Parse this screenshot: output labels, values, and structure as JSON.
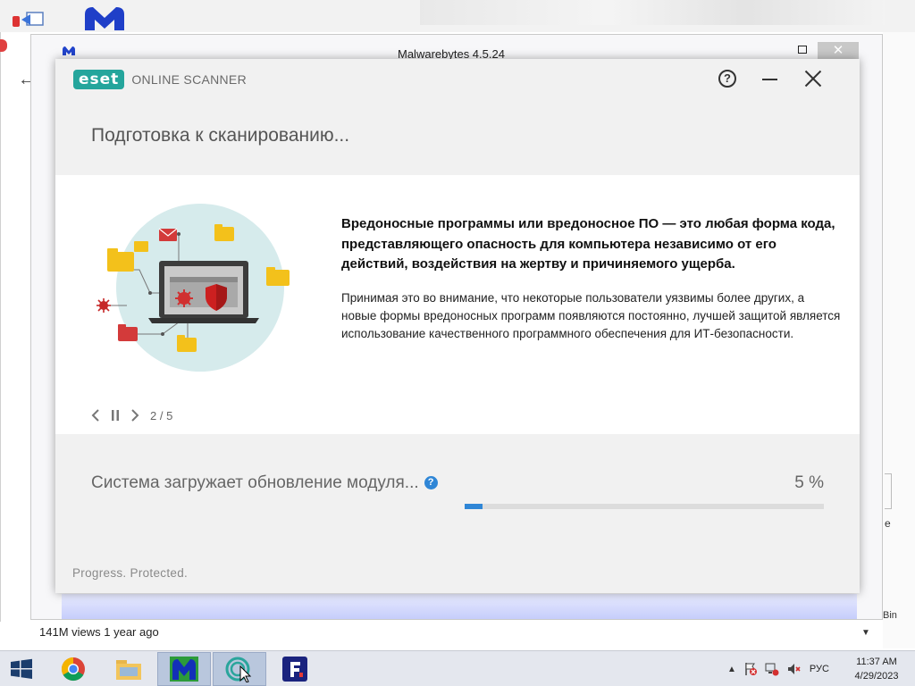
{
  "background": {
    "malwarebytes_title": "Malwarebytes 4.5.24",
    "views_text": "141M views  1 year ago",
    "bin_label": "Bin"
  },
  "eset": {
    "logo_text": "eset",
    "product_name": "ONLINE SCANNER",
    "page_title": "Подготовка к сканированию...",
    "info_heading": "Вредоносные программы или вредоносное ПО — это любая форма кода, представляющего опасность для компьютера независимо от его действий, воздействия на жертву и причиняемого ущерба.",
    "info_body": "Принимая это во внимание, что некоторые пользователи уязвимы более других, а новые формы вредоносных программ появляются постоянно, лучшей защитой является использование качественного программного обеспечения для ИТ-безопасности.",
    "carousel_counter": "2 / 5",
    "status_text": "Система загружает обновление модуля...",
    "status_help": "?",
    "percent_text": "5 %",
    "progress_fraction": 0.05,
    "tagline": "Progress. Protected.",
    "help_glyph": "?"
  },
  "taskbar": {
    "language": "РУС",
    "time": "11:37 AM",
    "date": "4/29/2023"
  },
  "colors": {
    "eset_teal": "#24a59c",
    "progress_blue": "#2f86d6",
    "malwarebytes_blue": "#2244cc"
  }
}
